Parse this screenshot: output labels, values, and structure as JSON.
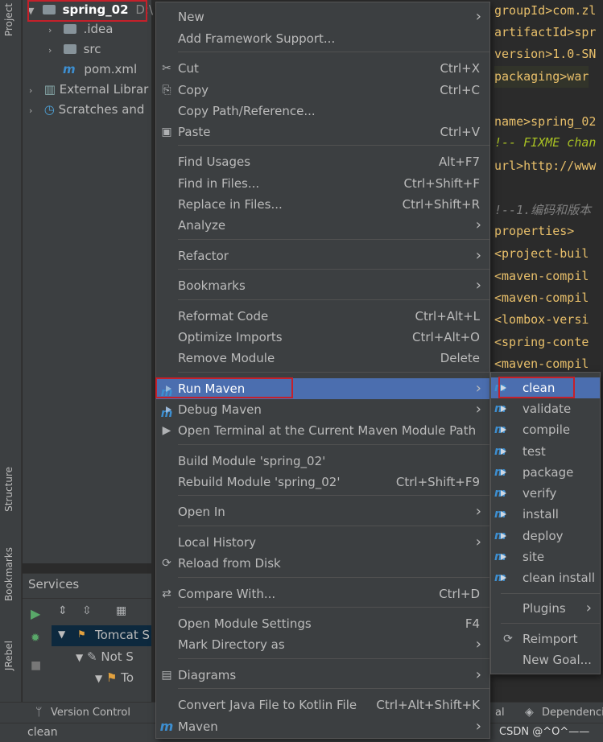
{
  "colors": {
    "selection": "#4b6eaf",
    "highlight_box": "#c5202a",
    "menu_bg": "#3c3f41",
    "editor_bg": "#2b2b2b"
  },
  "left_strip": {
    "tabs": [
      "Project",
      "Structure",
      "Bookmarks",
      "JRebel"
    ]
  },
  "project_tree": {
    "root": {
      "name": "spring_02",
      "path": "D:\\"
    },
    "items": [
      ".idea",
      "src",
      "pom.xml",
      "External Librar",
      "Scratches and"
    ]
  },
  "editor": {
    "lines": [
      {
        "text": "groupId>com.zl",
        "kind": "tag"
      },
      {
        "text": "artifactId>spr",
        "kind": "tag"
      },
      {
        "text": "version>1.0-SN",
        "kind": "tag"
      },
      {
        "text": "packaging>war",
        "kind": "tag"
      },
      {
        "text": "",
        "kind": "txt"
      },
      {
        "text": "name>spring_02",
        "kind": "tag"
      },
      {
        "text": "!-- FIXME chan",
        "kind": "fixme"
      },
      {
        "text": "url>http://www",
        "kind": "tag"
      },
      {
        "text": "",
        "kind": "txt"
      },
      {
        "text": "!--1.编码和版本",
        "kind": "cmt"
      },
      {
        "text": "properties>",
        "kind": "tag"
      },
      {
        "text": " <project-buil",
        "kind": "tag"
      },
      {
        "text": " <maven-compil",
        "kind": "tag"
      },
      {
        "text": " <maven-compil",
        "kind": "tag"
      },
      {
        "text": " <lombox-versi",
        "kind": "tag"
      },
      {
        "text": " <spring-conte",
        "kind": "tag"
      },
      {
        "text": " <maven-compil",
        "kind": "tag"
      }
    ]
  },
  "context_menu": {
    "items": [
      {
        "label": "New",
        "shortcut": "",
        "submenu": true,
        "icon": ""
      },
      {
        "label": "Add Framework Support...",
        "shortcut": "",
        "submenu": false,
        "icon": ""
      },
      {
        "label": "Cut",
        "shortcut": "Ctrl+X",
        "submenu": false,
        "icon": "scissors-icon"
      },
      {
        "label": "Copy",
        "shortcut": "Ctrl+C",
        "submenu": false,
        "icon": "copy-icon"
      },
      {
        "label": "Copy Path/Reference...",
        "shortcut": "",
        "submenu": false,
        "icon": ""
      },
      {
        "label": "Paste",
        "shortcut": "Ctrl+V",
        "submenu": false,
        "icon": "clipboard-icon"
      },
      {
        "label": "Find Usages",
        "shortcut": "Alt+F7",
        "submenu": false,
        "icon": ""
      },
      {
        "label": "Find in Files...",
        "shortcut": "Ctrl+Shift+F",
        "submenu": false,
        "icon": ""
      },
      {
        "label": "Replace in Files...",
        "shortcut": "Ctrl+Shift+R",
        "submenu": false,
        "icon": ""
      },
      {
        "label": "Analyze",
        "shortcut": "",
        "submenu": true,
        "icon": ""
      },
      {
        "label": "Refactor",
        "shortcut": "",
        "submenu": true,
        "icon": ""
      },
      {
        "label": "Bookmarks",
        "shortcut": "",
        "submenu": true,
        "icon": ""
      },
      {
        "label": "Reformat Code",
        "shortcut": "Ctrl+Alt+L",
        "submenu": false,
        "icon": ""
      },
      {
        "label": "Optimize Imports",
        "shortcut": "Ctrl+Alt+O",
        "submenu": false,
        "icon": ""
      },
      {
        "label": "Remove Module",
        "shortcut": "Delete",
        "submenu": false,
        "icon": ""
      },
      {
        "label": "Run Maven",
        "shortcut": "",
        "submenu": true,
        "icon": "maven-run-icon"
      },
      {
        "label": "Debug Maven",
        "shortcut": "",
        "submenu": true,
        "icon": "maven-debug-icon"
      },
      {
        "label": "Open Terminal at the Current Maven Module Path",
        "shortcut": "",
        "submenu": false,
        "icon": "terminal-icon"
      },
      {
        "label": "Build Module 'spring_02'",
        "shortcut": "",
        "submenu": false,
        "icon": ""
      },
      {
        "label": "Rebuild Module 'spring_02'",
        "shortcut": "Ctrl+Shift+F9",
        "submenu": false,
        "icon": ""
      },
      {
        "label": "Open In",
        "shortcut": "",
        "submenu": true,
        "icon": ""
      },
      {
        "label": "Local History",
        "shortcut": "",
        "submenu": true,
        "icon": ""
      },
      {
        "label": "Reload from Disk",
        "shortcut": "",
        "submenu": false,
        "icon": "reload-icon"
      },
      {
        "label": "Compare With...",
        "shortcut": "Ctrl+D",
        "submenu": false,
        "icon": "compare-icon"
      },
      {
        "label": "Open Module Settings",
        "shortcut": "F4",
        "submenu": false,
        "icon": ""
      },
      {
        "label": "Mark Directory as",
        "shortcut": "",
        "submenu": true,
        "icon": ""
      },
      {
        "label": "Diagrams",
        "shortcut": "",
        "submenu": true,
        "icon": "diagram-icon"
      },
      {
        "label": "Convert Java File to Kotlin File",
        "shortcut": "Ctrl+Alt+Shift+K",
        "submenu": false,
        "icon": ""
      },
      {
        "label": "Maven",
        "shortcut": "",
        "submenu": true,
        "icon": "maven-icon"
      }
    ]
  },
  "maven_submenu": {
    "items": [
      "clean",
      "validate",
      "compile",
      "test",
      "package",
      "verify",
      "install",
      "deploy",
      "site",
      "clean install"
    ],
    "plugins": "Plugins",
    "reimport": "Reimport",
    "new_goal": "New Goal..."
  },
  "services": {
    "title": "Services",
    "items": [
      "Tomcat S",
      "Not S",
      "To"
    ]
  },
  "bottom_tabs": {
    "version_control": "Version Control",
    "right_partial": "al",
    "dependencies": "Dependencies"
  },
  "status_bar": {
    "text": "clean",
    "watermark": "CSDN @^O^——"
  }
}
